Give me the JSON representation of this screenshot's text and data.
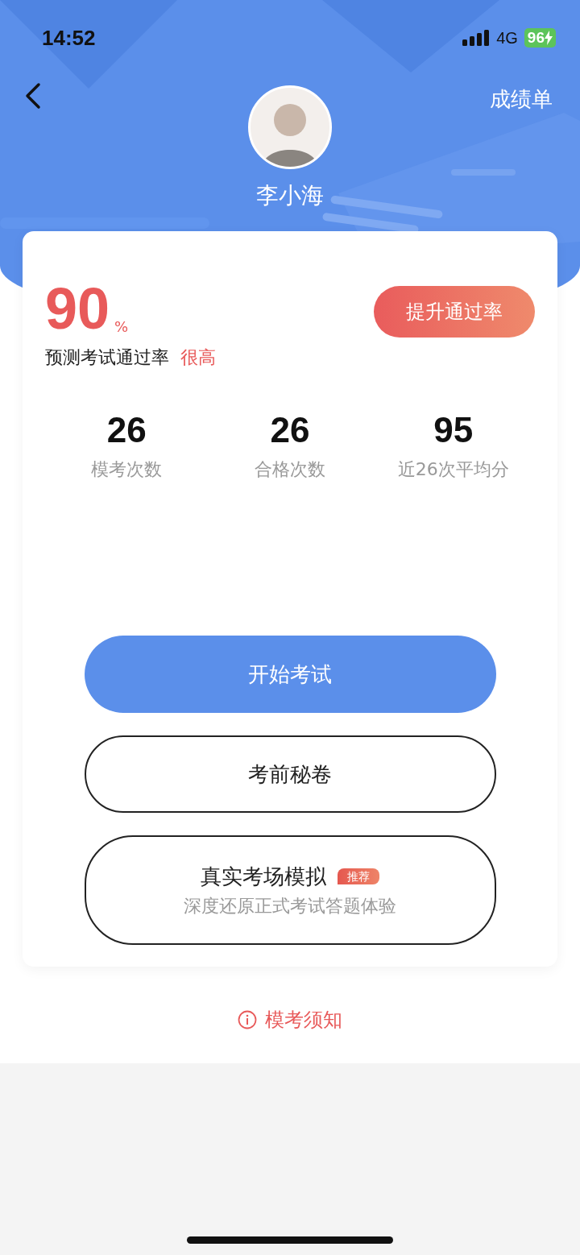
{
  "status_bar": {
    "time": "14:52",
    "network": "4G",
    "battery": "96",
    "charging": true
  },
  "nav": {
    "right_link": "成绩单"
  },
  "profile": {
    "name": "李小海"
  },
  "pass_rate": {
    "value": "90",
    "unit": "%",
    "label": "预测考试通过率",
    "rating": "很高",
    "button": "提升通过率"
  },
  "stats": [
    {
      "value": "26",
      "label": "模考次数"
    },
    {
      "value": "26",
      "label": "合格次数"
    },
    {
      "value": "95",
      "label": "近26次平均分"
    }
  ],
  "actions": [
    {
      "kind": "primary",
      "label": "开始考试"
    },
    {
      "kind": "outline",
      "label": "考前秘卷"
    },
    {
      "kind": "outline",
      "label": "真实考场模拟",
      "badge": "推荐",
      "subtitle": "深度还原正式考试答题体验"
    }
  ],
  "notice": {
    "label": "模考须知"
  }
}
